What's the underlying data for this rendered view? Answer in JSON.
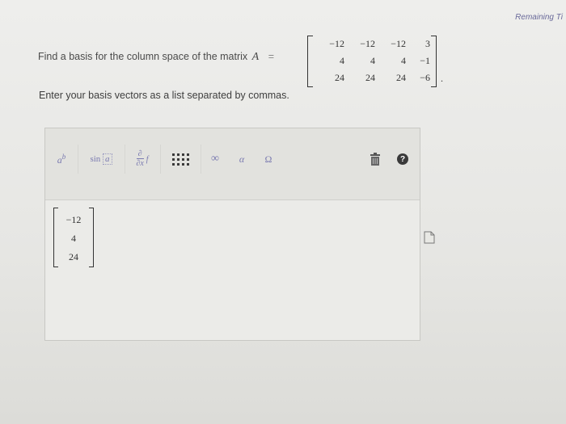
{
  "header": {
    "remaining": "Remaining Ti"
  },
  "question": {
    "text": "Find a basis for the column space of the matrix",
    "variable": "A",
    "equals": "=",
    "matrix": [
      [
        "−12",
        "−12",
        "−12",
        "3"
      ],
      [
        "4",
        "4",
        "4",
        "−1"
      ],
      [
        "24",
        "24",
        "24",
        "−6"
      ]
    ],
    "end_punct": "."
  },
  "instruction": "Enter your basis vectors as a list separated by commas.",
  "toolbar": {
    "power": {
      "base": "a",
      "exp": "b",
      "icon": "power-icon"
    },
    "sin": {
      "fn": "sin",
      "arg": "a",
      "icon": "sin-icon"
    },
    "derivative": {
      "num": "∂",
      "den": "∂x",
      "f": "f",
      "icon": "partial-derivative-icon"
    },
    "matrix": {
      "icon": "matrix-icon"
    },
    "infinity": "∞",
    "alpha": "α",
    "omega": "Ω",
    "trash": {
      "icon": "trash-icon"
    },
    "help": {
      "label": "?",
      "icon": "help-icon"
    }
  },
  "answer": {
    "vector": [
      "−12",
      "4",
      "24"
    ]
  },
  "colors": {
    "toolbar_icon": "#7a7ab0",
    "accent": "#6a6a9a"
  }
}
